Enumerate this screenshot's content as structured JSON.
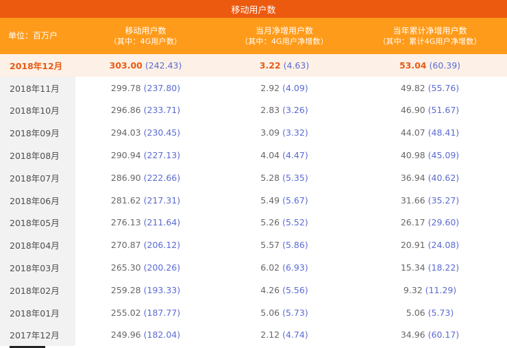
{
  "title": "移动用户数",
  "header": {
    "unit": "单位：百万户",
    "col1": {
      "main": "移动用户数",
      "sub": "（其中：4G用户数）"
    },
    "col2": {
      "main": "当月净增用户数",
      "sub": "（其中：4G用户净增数）"
    },
    "col3": {
      "main": "当年累计净增用户数",
      "sub": "（其中：累计4G用户净增数）"
    }
  },
  "rows": [
    {
      "month": "2018年12月",
      "v1": "303.00",
      "s1": "(242.43)",
      "v2": "3.22",
      "s2": "(4.63)",
      "v3": "53.04",
      "s3": "(60.39)"
    },
    {
      "month": "2018年11月",
      "v1": "299.78",
      "s1": "(237.80)",
      "v2": "2.92",
      "s2": "(4.09)",
      "v3": "49.82",
      "s3": "(55.76)"
    },
    {
      "month": "2018年10月",
      "v1": "296.86",
      "s1": "(233.71)",
      "v2": "2.83",
      "s2": "(3.26)",
      "v3": "46.90",
      "s3": "(51.67)"
    },
    {
      "month": "2018年09月",
      "v1": "294.03",
      "s1": "(230.45)",
      "v2": "3.09",
      "s2": "(3.32)",
      "v3": "44.07",
      "s3": "(48.41)"
    },
    {
      "month": "2018年08月",
      "v1": "290.94",
      "s1": "(227.13)",
      "v2": "4.04",
      "s2": "(4.47)",
      "v3": "40.98",
      "s3": "(45.09)"
    },
    {
      "month": "2018年07月",
      "v1": "286.90",
      "s1": "(222.66)",
      "v2": "5.28",
      "s2": "(5.35)",
      "v3": "36.94",
      "s3": "(40.62)"
    },
    {
      "month": "2018年06月",
      "v1": "281.62",
      "s1": "(217.31)",
      "v2": "5.49",
      "s2": "(5.67)",
      "v3": "31.66",
      "s3": "(35.27)"
    },
    {
      "month": "2018年05月",
      "v1": "276.13",
      "s1": "(211.64)",
      "v2": "5.26",
      "s2": "(5.52)",
      "v3": "26.17",
      "s3": "(29.60)"
    },
    {
      "month": "2018年04月",
      "v1": "270.87",
      "s1": "(206.12)",
      "v2": "5.57",
      "s2": "(5.86)",
      "v3": "20.91",
      "s3": "(24.08)"
    },
    {
      "month": "2018年03月",
      "v1": "265.30",
      "s1": "(200.26)",
      "v2": "6.02",
      "s2": "(6.93)",
      "v3": "15.34",
      "s3": "(18.22)"
    },
    {
      "month": "2018年02月",
      "v1": "259.28",
      "s1": "(193.33)",
      "v2": "4.26",
      "s2": "(5.56)",
      "v3": "9.32",
      "s3": "(11.29)"
    },
    {
      "month": "2018年01月",
      "v1": "255.02",
      "s1": "(187.77)",
      "v2": "5.06",
      "s2": "(5.73)",
      "v3": "5.06",
      "s3": "(5.73)"
    },
    {
      "month": "2017年12月",
      "v1": "249.96",
      "s1": "(182.04)",
      "v2": "2.12",
      "s2": "(4.74)",
      "v3": "34.96",
      "s3": "(60.17)"
    }
  ],
  "colors": {
    "title_bg": "#ec5a0f",
    "header_bg": "#ff9b1a",
    "highlight_text": "#ea5a12",
    "highlight_bg": "#fdf1e7",
    "sub_value": "#5a6ad0",
    "month_col_bg": "#f2f2f2"
  }
}
